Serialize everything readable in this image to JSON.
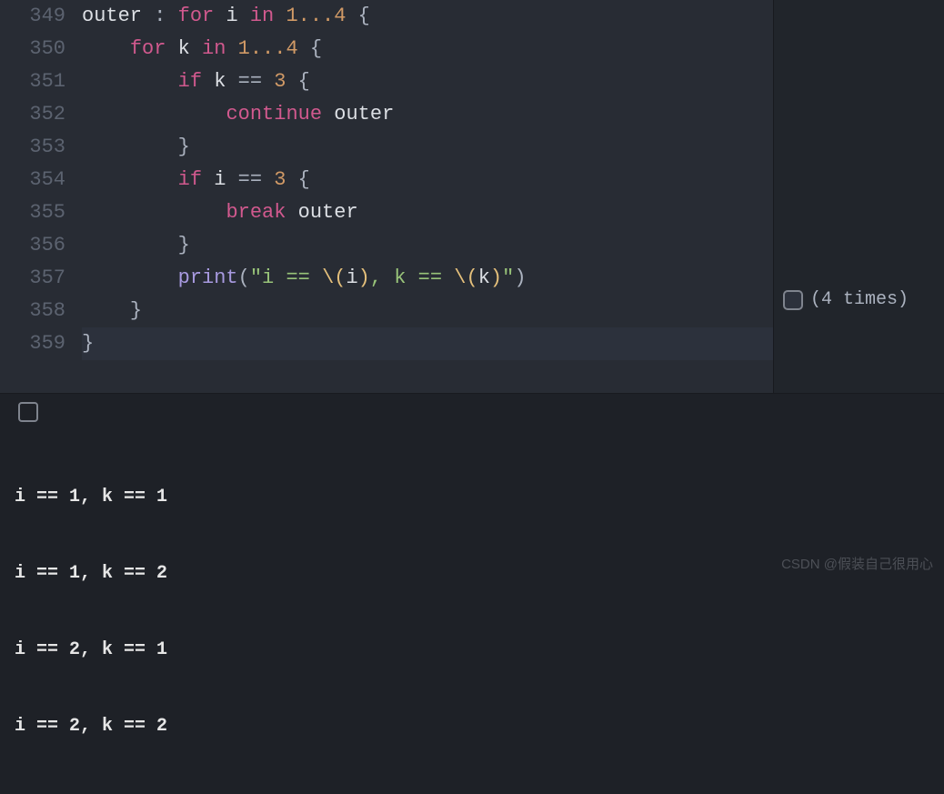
{
  "editor": {
    "lineNumbers": [
      "349",
      "350",
      "351",
      "352",
      "353",
      "354",
      "355",
      "356",
      "357",
      "358",
      "359"
    ],
    "highlightLine": 10,
    "tokens": {
      "outer": "outer",
      "colon": " : ",
      "for": "for",
      "i": "i",
      "k": "k",
      "in": "in",
      "range": "1...4",
      "lbrace": " {",
      "rbrace": "}",
      "if": "if",
      "eqeq": " == ",
      "three": "3",
      "continue": "continue",
      "break": "break",
      "print": "print",
      "strOpen": "(\"",
      "strIeq": "i == ",
      "esc1": "\\(",
      "iVar": "i",
      "esc1c": ")",
      "comma": ", k == ",
      "esc2": "\\(",
      "kVar": "k",
      "esc2c": ")",
      "strClose": "\")"
    }
  },
  "result": {
    "label": "(4 times)"
  },
  "console": {
    "lines": [
      "i == 1, k == 1",
      "i == 1, k == 2",
      "i == 2, k == 1",
      "i == 2, k == 2"
    ]
  },
  "watermark": "CSDN @假装自己很用心"
}
